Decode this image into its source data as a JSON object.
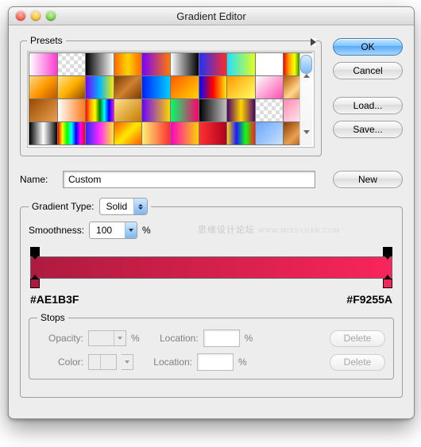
{
  "window": {
    "title": "Gradient Editor"
  },
  "preset_section": {
    "legend": "Presets"
  },
  "buttons": {
    "ok": "OK",
    "cancel": "Cancel",
    "load": "Load...",
    "save": "Save...",
    "new": "New"
  },
  "name": {
    "label": "Name:",
    "value": "Custom"
  },
  "gradient_type": {
    "label": "Gradient Type:",
    "value": "Solid",
    "smoothness_label": "Smoothness:",
    "smoothness_value": "100",
    "percent": "%"
  },
  "watermark": {
    "cn": "思缘设计论坛",
    "en": "WWW.MISSYUAN.COM"
  },
  "gradient": {
    "left_hex": "#AE1B3F",
    "right_hex": "#F9255A",
    "start_color": "#AE1B3F",
    "end_color": "#F9255A"
  },
  "stops": {
    "legend": "Stops",
    "opacity_label": "Opacity:",
    "percent": "%",
    "location_label": "Location:",
    "color_label": "Color:",
    "delete": "Delete",
    "opacity_value": "",
    "opacity_location": "",
    "color_value": "",
    "color_location": ""
  },
  "presets": [
    "linear-gradient(90deg,#fff,#ff3bd0)",
    "repeating-conic-gradient(#fff 0 25%,#ddd 0 50%) 0/10px 10px",
    "linear-gradient(90deg,#000,#fff)",
    "linear-gradient(90deg,#ff6a00,#ffd400,#ff6a00)",
    "linear-gradient(90deg,#7a00ff,#ff7a00)",
    "linear-gradient(90deg,#fff,#000)",
    "linear-gradient(90deg,#2030ff,#ff2a2a)",
    "linear-gradient(90deg,#20e0ff,#e0ff20)",
    "linear-gradient(90deg,#fff,#fff)",
    "linear-gradient(90deg,red,orange,yellow,green,blue,violet)",
    "linear-gradient(135deg,#ffd78a,#ff9a00,#b85400)",
    "linear-gradient(135deg,#ffe28a,#ffb000,#8a4a00)",
    "linear-gradient(90deg,#7a00ff,#00b7ff,#ffea00)",
    "linear-gradient(135deg,#7a3a00,#d08030,#7a3a00)",
    "linear-gradient(90deg,#0020ff,#00d0ff)",
    "linear-gradient(135deg,#ff5a00,#ffd400)",
    "linear-gradient(90deg,#0008ff,#ff0000,#ffea00)",
    "linear-gradient(135deg,#ff9a00,#ffff66)",
    "linear-gradient(135deg,#fff,#ff4fb0)",
    "linear-gradient(135deg,#b85400,#ffd78a,#b85400)",
    "linear-gradient(135deg,#9a4a00,#e8a050)",
    "linear-gradient(90deg,#fff,#ff7a1a)",
    "linear-gradient(90deg,red,orange,yellow,green,cyan,blue,magenta)",
    "linear-gradient(135deg,#ffe08a,#c67a00)",
    "linear-gradient(90deg,#6a00ff,#ffd400)",
    "linear-gradient(90deg,#00ff6a,#ff006a)",
    "linear-gradient(90deg,#000,#c0c0c0)",
    "linear-gradient(90deg,#4a006a,#ffd400,#4a006a)",
    "repeating-conic-gradient(#fff 0 25%,#ddd 0 50%) 0/10px 10px",
    "linear-gradient(135deg,#ff8ab0,#fff)",
    "linear-gradient(90deg,#000,#fff,#000)",
    "linear-gradient(90deg,red,yellow,lime,cyan,blue,magenta,red)",
    "linear-gradient(90deg,#2a2aff,#ff2aff,#ffea2a)",
    "linear-gradient(135deg,#ff5a00,#ffea00,#ff5a00)",
    "linear-gradient(90deg,#fff176,#ff3030)",
    "linear-gradient(90deg,#ff00c0,#ffd400)",
    "linear-gradient(90deg,#ff3030,#b00020)",
    "linear-gradient(90deg,#ffd400,#1a1aff,#12ff12,#ff1a1a)",
    "linear-gradient(135deg,#6aa6ff,#c8e0ff)",
    "linear-gradient(135deg,#8a3a00,#e8a050,#8a3a00)"
  ]
}
